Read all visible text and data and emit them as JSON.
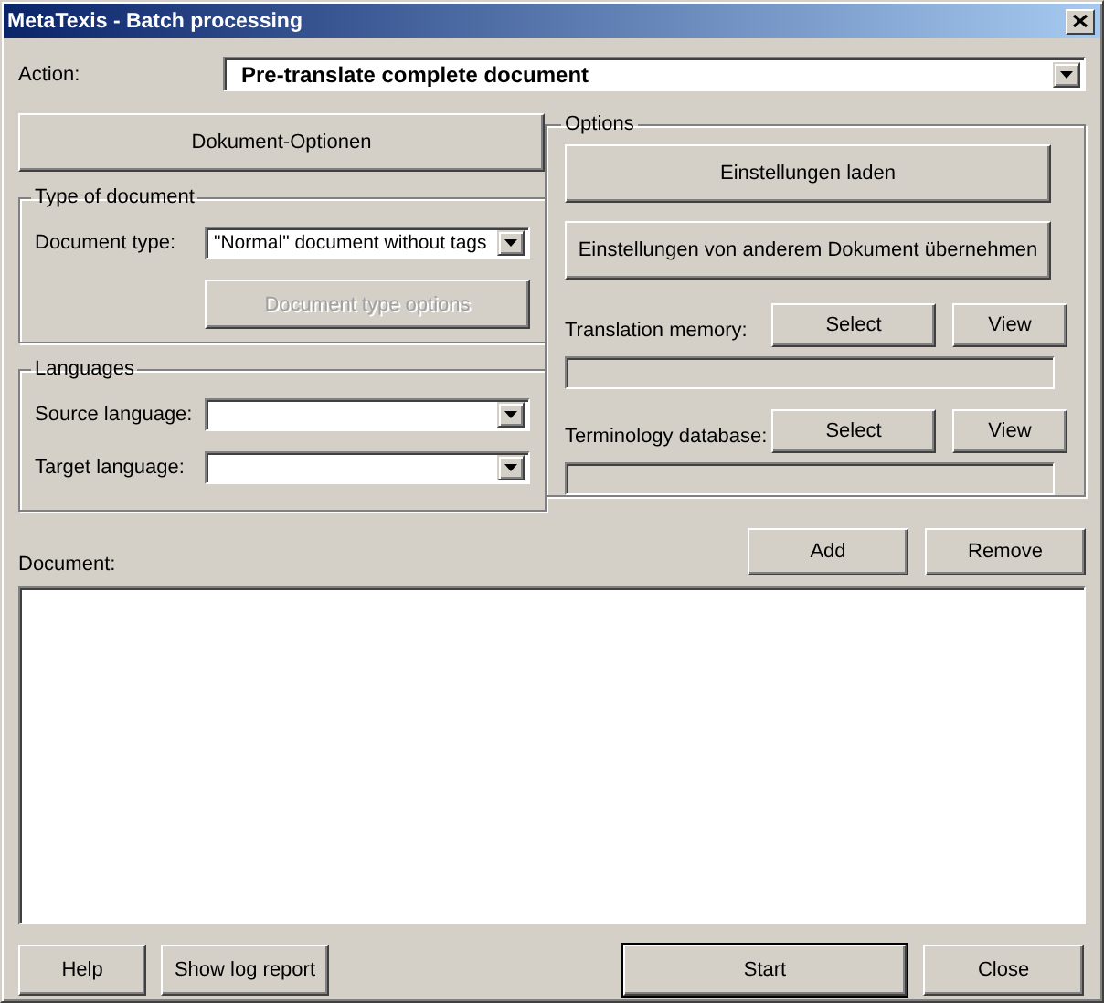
{
  "window": {
    "title": "MetaTexis - Batch processing"
  },
  "action": {
    "label": "Action:",
    "value": "Pre-translate complete document"
  },
  "document_options_button": {
    "label": "Dokument-Optionen"
  },
  "type_of_document": {
    "title": "Type of document",
    "document_type": {
      "label": "Document type:",
      "value": "\"Normal\" document without tags"
    },
    "options_button": {
      "label": "Document type options",
      "disabled": true
    }
  },
  "languages": {
    "title": "Languages",
    "fields": [
      {
        "label": "Source language:"
      },
      {
        "label": "Target language:"
      }
    ]
  },
  "options": {
    "title": "Options",
    "buttons": [
      {
        "label": "Einstellungen laden"
      },
      {
        "label": "Einstellungen von anderem Dokument übernehmen"
      }
    ],
    "resources": [
      {
        "label": "Translation memory:",
        "buttons": [
          "Select",
          "View"
        ]
      },
      {
        "label": "Terminology database:",
        "buttons": [
          "Select",
          "View"
        ]
      }
    ]
  },
  "document": {
    "label": "Document:",
    "buttons": [
      "Add",
      "Remove"
    ]
  },
  "footer_buttons": [
    {
      "label": "Help",
      "default": false
    },
    {
      "label": "Show log report",
      "default": false
    },
    {
      "label": "Start",
      "default": true
    },
    {
      "label": "Close",
      "default": false
    }
  ]
}
